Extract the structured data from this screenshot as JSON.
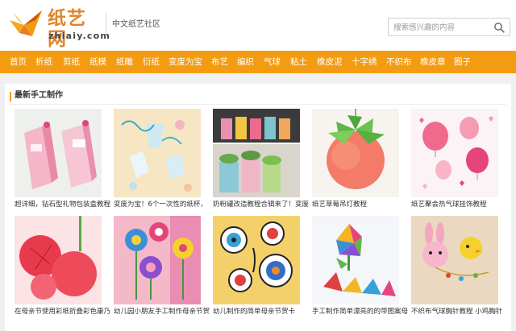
{
  "header": {
    "logo_cn": "纸艺网",
    "logo_en": "zhiaiy.com",
    "tagline": "中文纸艺社区",
    "search_placeholder": "搜索感兴趣的内容"
  },
  "nav": {
    "items": [
      "首页",
      "折纸",
      "剪纸",
      "纸模",
      "纸雕",
      "衍纸",
      "变废为宝",
      "布艺",
      "编织",
      "气球",
      "粘土",
      "橡皮泥",
      "十字绣",
      "不织布",
      "橡皮章",
      "圈子"
    ]
  },
  "main": {
    "section_title": "最新手工制作",
    "row1": [
      {
        "caption": "超详细，钻石型礼物包装盒教程"
      },
      {
        "caption": "变废为宝！6个一次性的纸杯，"
      },
      {
        "caption": "奶粉罐改造教程合辑来了！变废"
      },
      {
        "caption": "纸艺草莓吊灯教程"
      },
      {
        "caption": "纸艺聚会热气球挂饰教程"
      }
    ],
    "row2": [
      {
        "caption": "在母亲节使用彩纸折叠彩色康乃"
      },
      {
        "caption": "幼儿园小朋友手工制作母亲节贺"
      },
      {
        "caption": "幼儿制作的简单母亲节贺卡"
      },
      {
        "caption": "手工制作简单漂亮的的带图案母"
      },
      {
        "caption": "不织布气球胸针教程 小鸡胸针"
      }
    ]
  },
  "colors": {
    "nav_bg": "#f39c12",
    "brand_orange": "#e1852a"
  }
}
